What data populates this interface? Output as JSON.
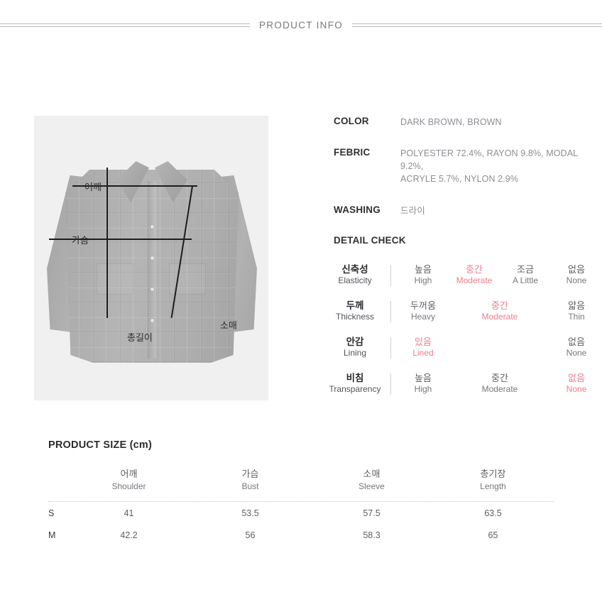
{
  "header": {
    "title": "PRODUCT INFO"
  },
  "photo": {
    "measurements": [
      {
        "name": "shoulder",
        "label": "어깨"
      },
      {
        "name": "bust",
        "label": "가슴"
      },
      {
        "name": "length",
        "label": "총길이"
      },
      {
        "name": "sleeve",
        "label": "소매"
      }
    ]
  },
  "info": {
    "rows": [
      {
        "key": "COLOR",
        "value": "DARK BROWN, BROWN"
      },
      {
        "key": "FEBRIC",
        "value": "POLYESTER 72.4%, RAYON 9.8%, MODAL 9.2%,\nACRYLE 5.7%, NYLON 2.9%"
      },
      {
        "key": "WASHING",
        "value": "드라이"
      }
    ]
  },
  "detail_check": {
    "title": "DETAIL CHECK",
    "highlight_color": "#ed7c8e",
    "rows": [
      {
        "label_ko": "신축성",
        "label_en": "Elasticity",
        "options": [
          {
            "ko": "높음",
            "en": "High",
            "selected": false
          },
          {
            "ko": "중간",
            "en": "Moderate",
            "selected": true
          },
          {
            "ko": "조금",
            "en": "A Little",
            "selected": false
          },
          {
            "ko": "없음",
            "en": "None",
            "selected": false
          }
        ]
      },
      {
        "label_ko": "두께",
        "label_en": "Thickness",
        "options": [
          {
            "ko": "두꺼움",
            "en": "Heavy",
            "selected": false
          },
          {
            "ko": "중간",
            "en": "Moderate",
            "selected": true,
            "wide": true
          },
          {
            "ko": "얇음",
            "en": "Thin",
            "selected": false
          }
        ]
      },
      {
        "label_ko": "안감",
        "label_en": "Lining",
        "options": [
          {
            "ko": "있음",
            "en": "Lined",
            "selected": true
          },
          {
            "ko": "",
            "en": "",
            "selected": false,
            "blank": true
          },
          {
            "ko": "",
            "en": "",
            "selected": false,
            "blank": true
          },
          {
            "ko": "없음",
            "en": "None",
            "selected": false
          }
        ]
      },
      {
        "label_ko": "비침",
        "label_en": "Transparency",
        "options": [
          {
            "ko": "높음",
            "en": "High",
            "selected": false
          },
          {
            "ko": "중간",
            "en": "Moderate",
            "selected": false,
            "wide": true
          },
          {
            "ko": "없음",
            "en": "None",
            "selected": true
          }
        ]
      }
    ]
  },
  "product_size": {
    "title": "PRODUCT SIZE (cm)",
    "columns": [
      {
        "ko": "어깨",
        "en": "Shoulder"
      },
      {
        "ko": "가슴",
        "en": "Bust"
      },
      {
        "ko": "소매",
        "en": "Sleeve"
      },
      {
        "ko": "총기장",
        "en": "Length"
      }
    ],
    "rows": [
      {
        "size": "S",
        "values": [
          "41",
          "53.5",
          "57.5",
          "63.5"
        ]
      },
      {
        "size": "M",
        "values": [
          "42.2",
          "56",
          "58.3",
          "65"
        ]
      }
    ]
  }
}
